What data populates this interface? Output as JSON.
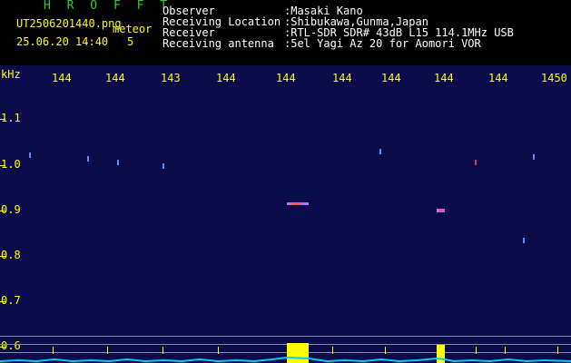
{
  "header": {
    "app_name": "H R O F F T",
    "filename": "UT2506201440.png",
    "tag": "meteor",
    "date_time": "25.06.20 14:40",
    "count": "5",
    "labels": [
      "Observer",
      "Receiving Location",
      "Receiver",
      "Receiving antenna"
    ],
    "values": [
      ":Masaki Kano",
      ":Shibukawa,Gunma,Japan",
      ":RTL-SDR SDR# 43dB L15 114.1MHz USB",
      ":5el Yagi Az 20 for Aomori VOR"
    ]
  },
  "plot": {
    "y_unit": "kHz",
    "y_ticks": [
      "1.1",
      "1.0",
      "0.9",
      "0.8",
      "0.7",
      "0.6"
    ],
    "x_ticks": [
      "144",
      "144",
      "143",
      "144",
      "144",
      "144",
      "144",
      "144",
      "144",
      "1450"
    ],
    "colors": {
      "background": "#0c0c4a",
      "axis": "#ffff00",
      "trace": "#00ccff"
    }
  }
}
